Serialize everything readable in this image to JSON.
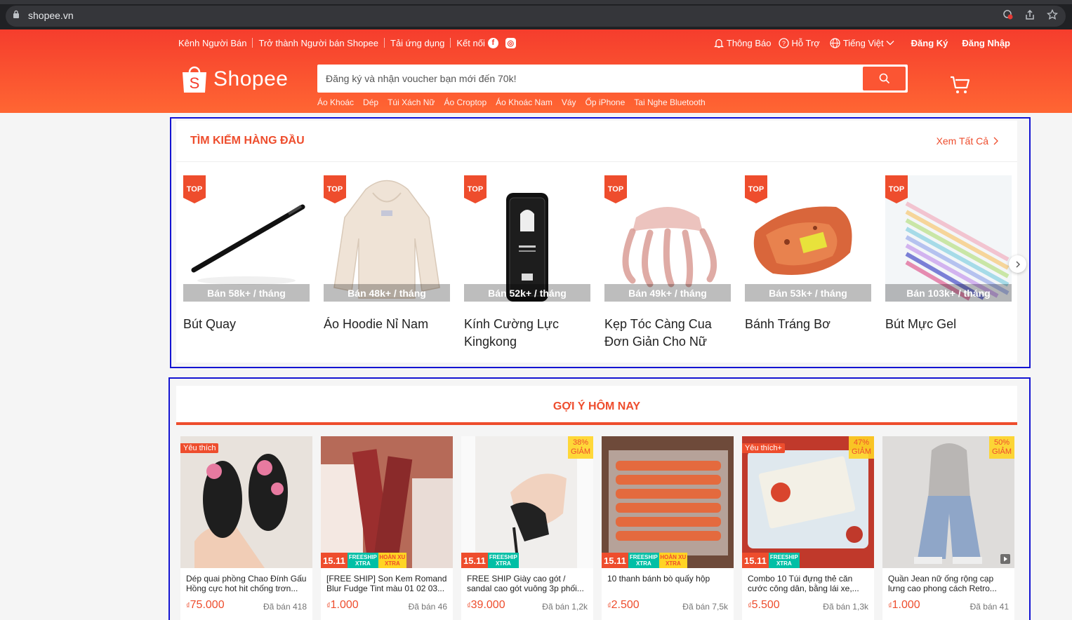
{
  "browser": {
    "url": "shopee.vn"
  },
  "header": {
    "top_links": [
      "Kênh Người Bán",
      "Trở thành Người bán Shopee",
      "Tải ứng dụng"
    ],
    "connect_label": "Kết nối",
    "notifications": "Thông Báo",
    "support": "Hỗ Trợ",
    "language": "Tiếng Việt",
    "register": "Đăng Ký",
    "login": "Đăng Nhập",
    "logo_text": "Shopee",
    "search_placeholder": "Đăng ký và nhận voucher bạn mới đến 70k!",
    "suggestions": [
      "Áo Khoác",
      "Dép",
      "Túi Xách Nữ",
      "Áo Croptop",
      "Áo Khoác Nam",
      "Váy",
      "Ốp iPhone",
      "Tai Nghe Bluetooth"
    ]
  },
  "top_search": {
    "title": "TÌM KIẾM HÀNG ĐẦU",
    "see_all": "Xem Tất Cả",
    "badge": "TOP",
    "items": [
      {
        "name": "Bút Quay",
        "sold": "Bán 58k+ / tháng"
      },
      {
        "name": "Áo Hoodie Nỉ Nam",
        "sold": "Bán 48k+ / tháng"
      },
      {
        "name": "Kính Cường Lực Kingkong",
        "sold": "Bán 52k+ / tháng"
      },
      {
        "name": "Kẹp Tóc Càng Cua Đơn Giản Cho Nữ",
        "sold": "Bán 49k+ / tháng"
      },
      {
        "name": "Bánh Tráng Bơ",
        "sold": "Bán 53k+ / tháng"
      },
      {
        "name": "Bút Mực Gel",
        "sold": "Bán 103k+ / tháng"
      }
    ]
  },
  "recommend": {
    "title": "GỢI Ý HÔM NAY",
    "currency": "₫",
    "promo_date": "15.11",
    "freeship": "FREESHIP XTRA",
    "hoanxu": "HOÀN XU XTRA",
    "discount_word": "GIẢM",
    "products": [
      {
        "name": "Dép quai phồng Chao Đính Gấu Hồng cực hot hit chống trơn...",
        "price": "75.000",
        "sold": "Đã bán 418",
        "tag": "Yêu thích",
        "discount": ""
      },
      {
        "name": "[FREE SHIP] Son Kem Romand Blur Fudge Tint màu 01 02 03...",
        "price": "1.000",
        "sold": "Đã bán 46",
        "tag": "",
        "discount": ""
      },
      {
        "name": "FREE SHIP Giày cao gót / sandal cao gót vuông 3p phối...",
        "price": "39.000",
        "sold": "Đã bán 1,2k",
        "tag": "",
        "discount": "38%"
      },
      {
        "name": "10 thanh bánh bò quấy hộp",
        "price": "2.500",
        "sold": "Đã bán 7,5k",
        "tag": "",
        "discount": ""
      },
      {
        "name": "Combo 10 Túi đựng thẻ căn cước công dân, bằng lái xe,...",
        "price": "5.500",
        "sold": "Đã bán 1,3k",
        "tag": "Yêu thích+",
        "discount": "47%"
      },
      {
        "name": "Quần Jean nữ ống rộng cạp lưng cao phong cách Retro...",
        "price": "1.000",
        "sold": "Đã bán 41",
        "tag": "",
        "discount": "50%"
      }
    ]
  }
}
